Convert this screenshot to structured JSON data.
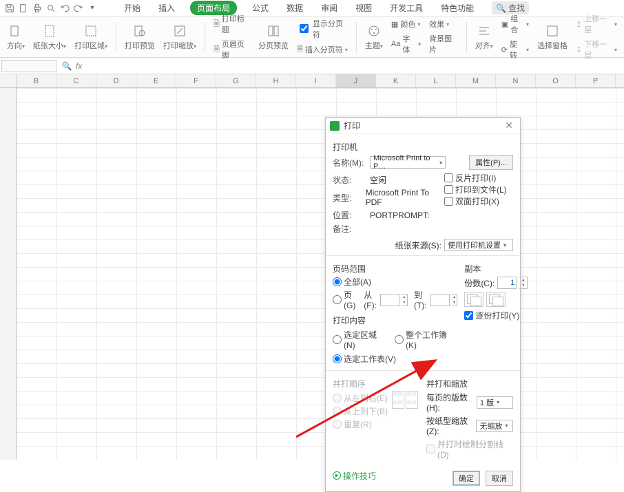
{
  "tabs": {
    "start": "开始",
    "insert": "插入",
    "pagelayout": "页面布局",
    "formula": "公式",
    "data": "数据",
    "review": "审阅",
    "view": "视图",
    "dev": "开发工具",
    "special": "特色功能"
  },
  "search": {
    "placeholder": "查找"
  },
  "ribbon": {
    "direction": "方向",
    "papersize": "纸张大小",
    "printarea": "打印区域",
    "printpreview": "打印预览",
    "printscale": "打印缩放",
    "printtitle": "打印标题",
    "headerfooter": "页眉页脚",
    "showbreaks": "显示分页符",
    "insertbreak": "插入分页符",
    "splitpreview": "分页预览",
    "theme": "主题",
    "color": "颜色",
    "font": "字体",
    "effect": "效果",
    "bgpic": "背景图片",
    "align": "对齐",
    "group": "组合",
    "rotate": "旋转",
    "selpane": "选择窗格",
    "moveup": "上移一层",
    "movedown": "下移一层"
  },
  "columns": [
    "B",
    "C",
    "D",
    "E",
    "F",
    "G",
    "H",
    "I",
    "J",
    "K",
    "L",
    "M",
    "N",
    "O",
    "P"
  ],
  "active_col": "J",
  "dialog": {
    "title": "打印",
    "section_printer": "打印机",
    "name_label": "名称(M):",
    "name_value": "Microsoft Print to P…",
    "properties": "属性(P)...",
    "status_label": "状态:",
    "status_value": "空闲",
    "type_label": "类型:",
    "type_value": "Microsoft Print To PDF",
    "where_label": "位置:",
    "where_value": "PORTPROMPT:",
    "comment_label": "备注:",
    "opt_reverse": "反片打印(I)",
    "opt_tofile": "打印到文件(L)",
    "opt_duplex": "双面打印(X)",
    "papersrc_label": "纸张来源(S):",
    "papersrc_value": "使用打印机设置",
    "section_range": "页码范围",
    "range_all": "全部(A)",
    "range_pages": "页(G)",
    "from_label": "从(F):",
    "to_label": "到(T):",
    "section_copies": "副本",
    "copies_label": "份数(C):",
    "copies_value": "1",
    "collate": "逐份打印(Y)",
    "section_content": "打印内容",
    "content_selection": "选定区域(N)",
    "content_workbook": "整个工作簿(K)",
    "content_sheets": "选定工作表(V)",
    "section_order": "并打顺序",
    "order_lr": "从左到右(E)",
    "order_tb": "从上到下(B)",
    "order_repeat": "重复(R)",
    "section_zoom": "并打和缩放",
    "perpage_label": "每页的版数(H):",
    "perpage_value": "1 版",
    "scale_label": "按纸型缩放(Z):",
    "scale_value": "无缩放",
    "drawlines": "并打时绘制分割线(D)",
    "tips": "操作技巧",
    "ok": "确定",
    "cancel": "取消"
  }
}
